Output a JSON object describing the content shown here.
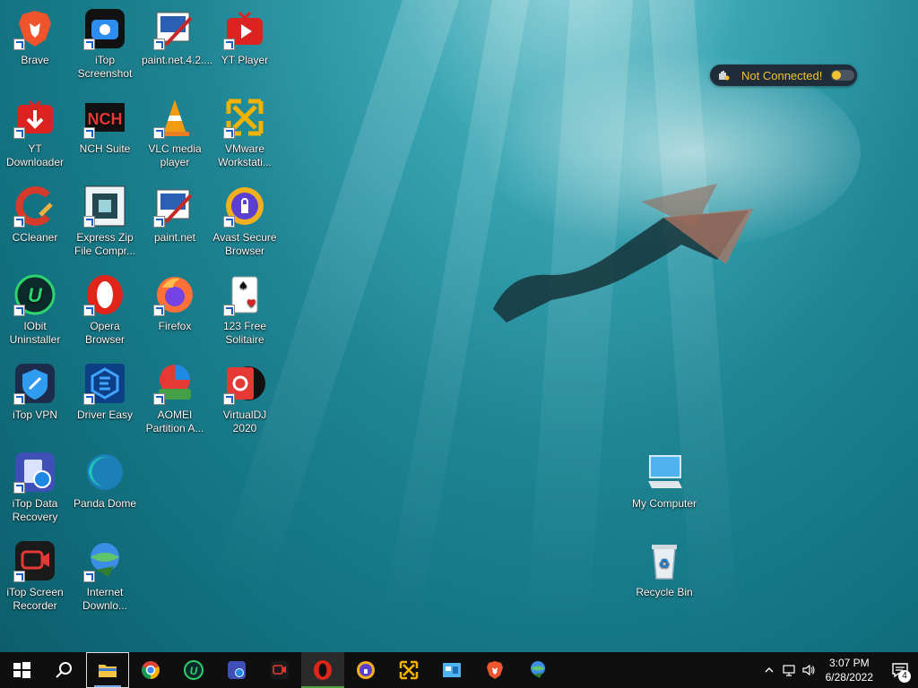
{
  "desktop_icons": {
    "brave": "Brave",
    "itop_screenshot": "iTop Screenshot",
    "paint_net_42": "paint.net.4.2....",
    "yt_player": "YT Player",
    "yt_downloader": "YT Downloader",
    "nch_suite": "NCH Suite",
    "vlc": "VLC media player",
    "vmware": "VMware Workstati...",
    "ccleaner": "CCleaner",
    "express_zip": "Express Zip File Compr...",
    "paint_net": "paint.net",
    "avast": "Avast Secure Browser",
    "iobit": "IObit Uninstaller",
    "opera": "Opera Browser",
    "firefox": "Firefox",
    "solitaire": "123 Free Solitaire",
    "itop_vpn": "iTop VPN",
    "driver_easy": "Driver Easy",
    "aomei": "AOMEI Partition A...",
    "virtualdj": "VirtualDJ 2020",
    "itop_data_recovery": "iTop Data Recovery",
    "panda_dome": "Panda Dome",
    "itop_screen_recorder": "iTop Screen Recorder",
    "internet_download": "Internet Downlo...",
    "my_computer": "My Computer",
    "recycle_bin": "Recycle Bin"
  },
  "vpn_widget": {
    "status": "Not Connected!"
  },
  "taskbar": {
    "clock_time": "3:07 PM",
    "clock_date": "6/28/2022",
    "notification_count": "4"
  },
  "colors": {
    "taskbar_bg": "#0f0f10",
    "vpn_status": "#f2c230",
    "desktop_water": "#1e8493"
  }
}
